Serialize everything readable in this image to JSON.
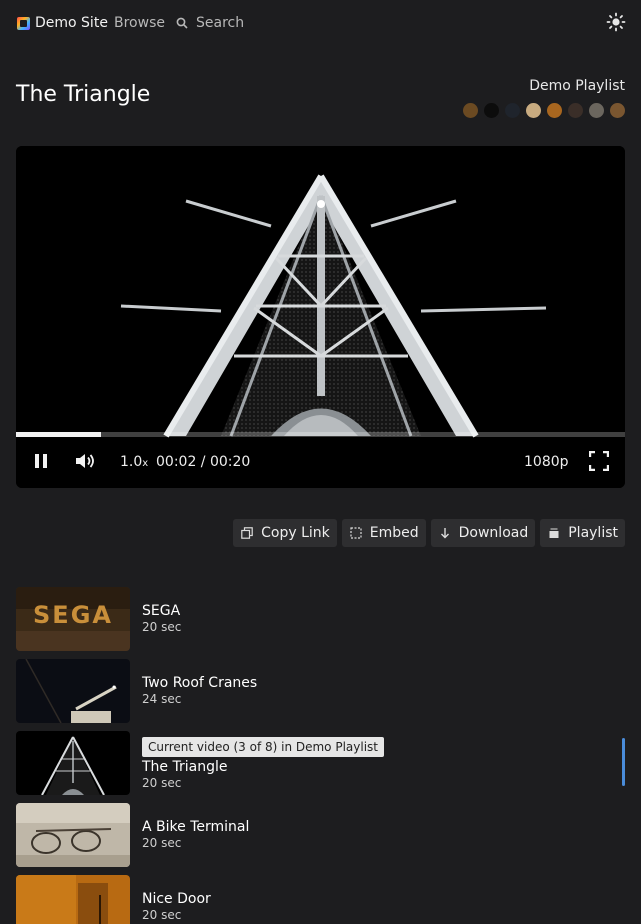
{
  "header": {
    "site_name": "Demo Site",
    "browse_label": "Browse",
    "search_placeholder": "Search",
    "theme_icon": "sun-icon"
  },
  "video": {
    "title": "The Triangle",
    "playlist_name": "Demo Playlist",
    "palette": [
      "#6b4a22",
      "#0c0c0c",
      "#1f242c",
      "#c8ab80",
      "#a8661f",
      "#3a2e28",
      "#6b665e",
      "#7a5630"
    ]
  },
  "player": {
    "progress": 0.14,
    "speed": "1.0",
    "speed_suffix": "x",
    "time": "00:02 / 00:20",
    "quality": "1080p",
    "icons": [
      "pause-icon",
      "volume-icon",
      "fullscreen-icon"
    ]
  },
  "actions": {
    "copy_link": "Copy Link",
    "embed": "Embed",
    "download": "Download",
    "playlist": "Playlist"
  },
  "list": {
    "items": [
      {
        "title": "SEGA",
        "duration": "20 sec"
      },
      {
        "title": "Two Roof Cranes",
        "duration": "24 sec"
      },
      {
        "title": "The Triangle",
        "duration": "20 sec",
        "badge": "Current video (3 of 8) in Demo Playlist"
      },
      {
        "title": "A Bike Terminal",
        "duration": "20 sec"
      },
      {
        "title": "Nice Door",
        "duration": "20 sec"
      }
    ]
  }
}
